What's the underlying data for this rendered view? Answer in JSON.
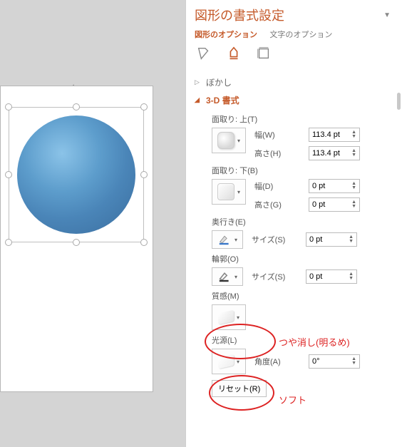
{
  "panel": {
    "title": "図形の書式設定",
    "tabs": {
      "shape": "図形のオプション",
      "text": "文字のオプション"
    }
  },
  "sections": {
    "blur": "ぼかし",
    "threeD": "3-D 書式"
  },
  "bevel": {
    "topLabel": "面取り: 上(T)",
    "bottomLabel": "面取り: 下(B)",
    "widthLabel": "幅(W)",
    "heightLabel": "高さ(H)",
    "widthLabel2": "幅(D)",
    "heightLabel2": "高さ(G)",
    "topWidth": "113.4 pt",
    "topHeight": "113.4 pt",
    "bottomWidth": "0 pt",
    "bottomHeight": "0 pt"
  },
  "depth": {
    "label": "奥行き(E)",
    "sizeLabel": "サイズ(S)",
    "value": "0 pt"
  },
  "contour": {
    "label": "輪郭(O)",
    "sizeLabel": "サイズ(S)",
    "value": "0 pt"
  },
  "material": {
    "label": "質感(M)",
    "annotation": "つや消し(明るめ)"
  },
  "lighting": {
    "label": "光源(L)",
    "angleLabel": "角度(A)",
    "angleValue": "0°",
    "annotation": "ソフト"
  },
  "reset": "リセット(R)"
}
